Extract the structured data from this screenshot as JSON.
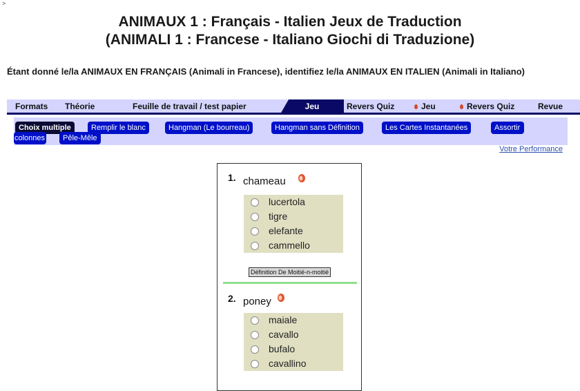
{
  "corner_mark": ">",
  "title": {
    "line1": "ANIMAUX 1 : Français - Italien Jeux de Traduction",
    "line2": "(ANIMALI 1 : Francese - Italiano Giochi di Traduzione)"
  },
  "instruction": "Étant donné le/la ANIMAUX EN FRANÇAIS (Animali in Francese), identifiez le/la ANIMAUX EN ITALIEN (Animali in Italiano)",
  "tabs": [
    {
      "label": "Formats"
    },
    {
      "label": "Théorie"
    },
    {
      "label": "Feuille de travail / test papier"
    },
    {
      "label": "Jeu",
      "active": true
    },
    {
      "label": "Revers Quiz"
    },
    {
      "label": "Jeu",
      "icon": "sound-icon"
    },
    {
      "label": "Revers Quiz",
      "icon": "sound-icon"
    },
    {
      "label": "Revue"
    }
  ],
  "modes": [
    {
      "label": "Choix multiple",
      "active": true
    },
    {
      "label": "Remplir le blanc"
    },
    {
      "label": "Hangman (Le bourreau)"
    },
    {
      "label": "Hangman sans Définition"
    },
    {
      "label": "Les Cartes Instantanées"
    },
    {
      "label": "Assortir colonnes"
    },
    {
      "label": "Pêle-Mêle"
    }
  ],
  "performance_link": "Votre Performance",
  "questions": [
    {
      "number": "1.",
      "word": "chameau",
      "icon": "speaker-icon",
      "choices": [
        "lucertola",
        "tigre",
        "elefante",
        "cammello"
      ],
      "hint_button": "Définition De Moitié-n-moitié"
    },
    {
      "number": "2.",
      "word": "poney",
      "icon": "speaker-icon",
      "choices": [
        "maiale",
        "cavallo",
        "bufalo",
        "cavallino"
      ]
    }
  ],
  "colors": {
    "tab_dark": "#0a0a66",
    "tab_bg": "#d4d4ff",
    "pill": "#0010c8",
    "choice_bg": "#e0dfc2",
    "separator": "#8fe08f"
  }
}
